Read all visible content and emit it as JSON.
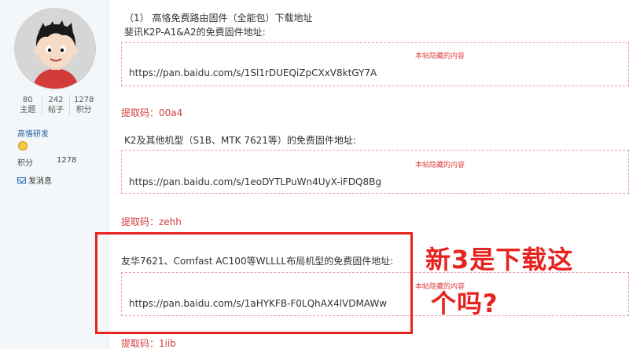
{
  "sidebar": {
    "stats": [
      {
        "value": "80",
        "label": "主题"
      },
      {
        "value": "242",
        "label": "帖子"
      },
      {
        "value": "1278",
        "label": "积分"
      }
    ],
    "group": "高恪研发",
    "points_label": "积分",
    "points_value": "1278",
    "message": "发消息"
  },
  "post": {
    "heading": "（1） 高恪免费路由固件（全能包）下载地址",
    "sections": [
      {
        "title": "斐讯K2P-A1&A2的免费固件地址:",
        "hidden_note": "本帖隐藏的内容",
        "link": "https://pan.baidu.com/s/1Sl1rDUEQiZpCXxV8ktGY7A",
        "code": "提取码：00a4"
      },
      {
        "title": "K2及其他机型（S1B、MTK 7621等）的免费固件地址:",
        "hidden_note": "本帖隐藏的内容",
        "link": "https://pan.baidu.com/s/1eoDYTLPuWn4UyX-iFDQ8Bg",
        "code": "提取码：zehh"
      },
      {
        "title": "友华7621、Comfast AC100等WLLLL布局机型的免费固件地址:",
        "hidden_note": "本帖隐藏的内容",
        "link": "https://pan.baidu.com/s/1aHYKFB-F0LQhAX4lVDMAWw",
        "code": "提取码：1iib"
      }
    ]
  },
  "annotation": {
    "line1": "新3是下载这",
    "line2": "个吗?"
  },
  "colors": {
    "accent_red": "#e8221e",
    "code_red": "#d23c3c",
    "link_blue": "#1f5fa0"
  }
}
